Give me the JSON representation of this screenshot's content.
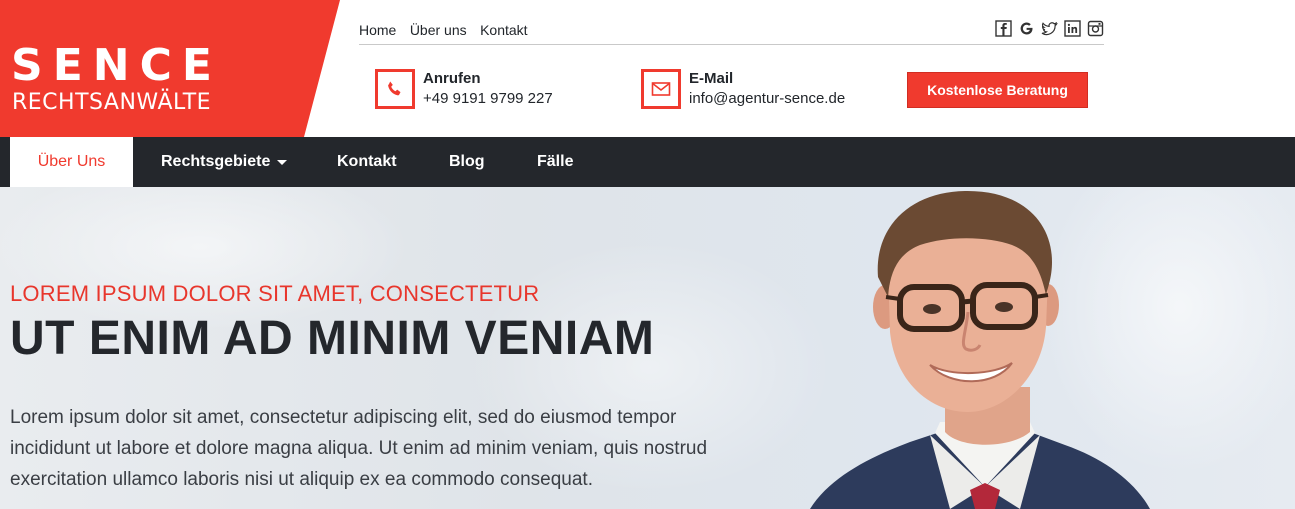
{
  "brand": {
    "name": "SENCE",
    "tagline": "RECHTSANWÄLTE"
  },
  "topnav": {
    "items": [
      "Home",
      "Über uns",
      "Kontakt"
    ]
  },
  "social": [
    "facebook-icon",
    "google-icon",
    "twitter-icon",
    "linkedin-icon",
    "instagram-icon"
  ],
  "contact": {
    "phone": {
      "label": "Anrufen",
      "value": "+49 9191 9799 227"
    },
    "email": {
      "label": "E-Mail",
      "value": "info@agentur-sence.de"
    }
  },
  "cta": {
    "label": "Kostenlose Beratung"
  },
  "mainnav": {
    "items": [
      "Über Uns",
      "Rechtsgebiete",
      "Kontakt",
      "Blog",
      "Fälle"
    ],
    "active": "Über Uns"
  },
  "hero": {
    "kicker": "LOREM IPSUM DOLOR SIT AMET, CONSECTETUR",
    "headline": "UT ENIM AD MINIM VENIAM",
    "lead": "Lorem ipsum dolor sit amet, consectetur adipiscing elit, sed do eiusmod tempor incididunt ut labore et dolore magna aliqua. Ut enim ad minim veniam, quis nostrud exercitation ullamco laboris nisi ut aliquip ex ea commodo consequat."
  },
  "colors": {
    "accent": "#f03a2e",
    "nav_bg": "#24272c",
    "text_dark": "#22262b"
  }
}
